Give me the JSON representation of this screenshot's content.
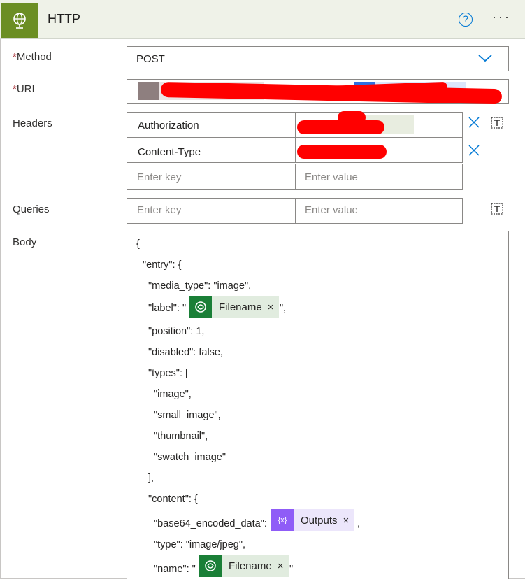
{
  "action": {
    "title": "HTTP",
    "icon": "globe-icon",
    "color": "#6b8e23",
    "help_symbol": "?",
    "more_symbol": "···"
  },
  "fields": {
    "method": {
      "label": "Method",
      "required_mark": "*",
      "value": "POST"
    },
    "uri": {
      "label": "URI",
      "required_mark": "*"
    },
    "headers": {
      "label": "Headers",
      "rows": [
        {
          "key": "Authorization"
        },
        {
          "key": "Content-Type"
        }
      ],
      "key_placeholder": "Enter key",
      "value_placeholder": "Enter value"
    },
    "queries": {
      "label": "Queries",
      "key_placeholder": "Enter key",
      "value_placeholder": "Enter value"
    },
    "body": {
      "label": "Body"
    }
  },
  "body_code": {
    "l1": "{",
    "l2": "\"entry\": {",
    "l3": "\"media_type\": \"image\",",
    "l4_pre": "\"label\": \"",
    "l4_post": "\",",
    "l5": "\"position\": 1,",
    "l6": "\"disabled\": false,",
    "l7": "\"types\": [",
    "l8": "\"image\",",
    "l9": "\"small_image\",",
    "l10": "\"thumbnail\",",
    "l11": "\"swatch_image\"",
    "l12": "],",
    "l13": "\"content\": {",
    "l14_pre": "\"base64_encoded_data\": ",
    "l14_post": ",",
    "l15": "\"type\": \"image/jpeg\",",
    "l16_pre": "\"name\": \"",
    "l16_post": "\""
  },
  "tokens": {
    "filename": {
      "label": "Filename",
      "close": "×",
      "color": "#1a7f37",
      "bg": "#e1ecdf"
    },
    "outputs": {
      "label": "Outputs",
      "close": "×",
      "color": "#8f5cf7",
      "bg": "#ece6fb",
      "symbol": "{x}"
    }
  },
  "colors": {
    "accent": "#0078d4",
    "redaction": "#ff0000"
  }
}
